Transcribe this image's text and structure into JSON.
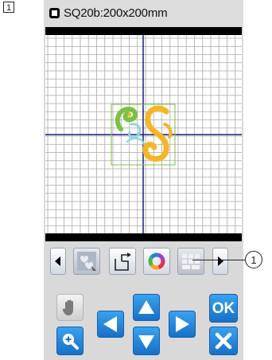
{
  "step": {
    "number": "1"
  },
  "titlebar": {
    "title": "SQ20b:200x200mm",
    "icon": "hoop-icon"
  },
  "toolbar": {
    "buttons": [
      {
        "name": "scroll-left-button",
        "icon": "triangle-left-icon"
      },
      {
        "name": "pattern-select-button",
        "icon": "hearts-icon"
      },
      {
        "name": "move-rotate-button",
        "icon": "rotate-frame-icon"
      },
      {
        "name": "color-button",
        "icon": "color-wheel-icon"
      },
      {
        "name": "layout-button",
        "icon": "grid-blocks-icon"
      },
      {
        "name": "scroll-right-button",
        "icon": "triangle-right-icon"
      }
    ],
    "callout_number": "1"
  },
  "controls": {
    "ok_label": "OK"
  },
  "colors": {
    "accent_blue": "#1e7fd8",
    "grid_line": "#aaaaaa",
    "axis_line": "#1b1f8a",
    "pattern_green": "#7cc142",
    "pattern_yellow": "#f5b623",
    "pattern_cyan": "#8fd6e0"
  }
}
